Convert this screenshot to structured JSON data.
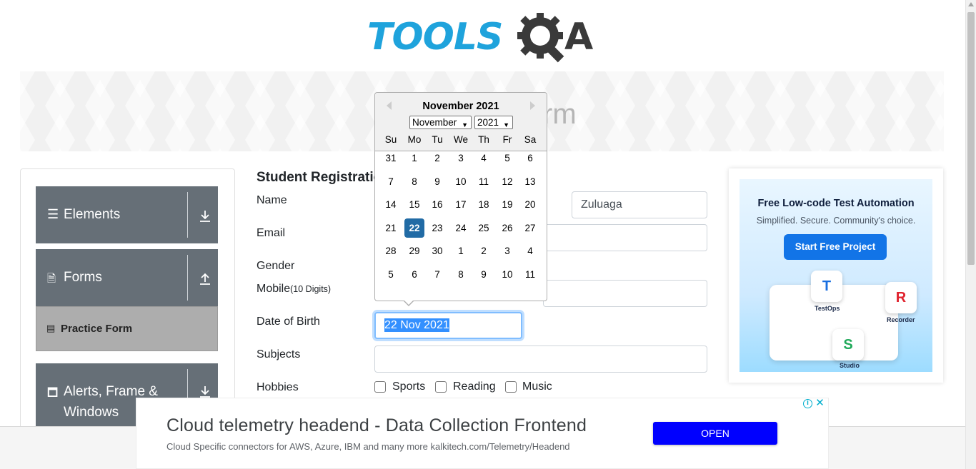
{
  "logo": {
    "text": "TOOLS",
    "suffix": "A"
  },
  "banner": {
    "title_fragment": "rm"
  },
  "sidebar": {
    "groups": [
      {
        "label": "Elements",
        "icon": "hamburger-icon",
        "arrow": "download-arrow-icon"
      },
      {
        "label": "Forms",
        "icon": "document-icon",
        "arrow": "upload-arrow-icon"
      },
      {
        "label_line1": "Alerts, Frame &",
        "label_line2": "Windows",
        "icon": "window-icon",
        "arrow": "download-arrow-icon"
      }
    ],
    "submenu": {
      "label": "Practice Form",
      "icon": "form-icon"
    }
  },
  "form": {
    "title": "Student Registratio",
    "labels": {
      "name": "Name",
      "email": "Email",
      "gender": "Gender",
      "mobile": "Mobile",
      "mobile_hint": "(10 Digits)",
      "dob": "Date of Birth",
      "subjects": "Subjects",
      "hobbies": "Hobbies"
    },
    "last_name": "Zuluaga",
    "dob_value": "22 Nov 2021",
    "hobbies": [
      "Sports",
      "Reading",
      "Music"
    ]
  },
  "datepicker": {
    "title": "November 2021",
    "month_select": "November",
    "year_select": "2021",
    "weekdays": [
      "Su",
      "Mo",
      "Tu",
      "We",
      "Th",
      "Fr",
      "Sa"
    ],
    "weeks": [
      [
        "31",
        "1",
        "2",
        "3",
        "4",
        "5",
        "6"
      ],
      [
        "7",
        "8",
        "9",
        "10",
        "11",
        "12",
        "13"
      ],
      [
        "14",
        "15",
        "16",
        "17",
        "18",
        "19",
        "20"
      ],
      [
        "21",
        "22",
        "23",
        "24",
        "25",
        "26",
        "27"
      ],
      [
        "28",
        "29",
        "30",
        "1",
        "2",
        "3",
        "4"
      ],
      [
        "5",
        "6",
        "7",
        "8",
        "9",
        "10",
        "11"
      ]
    ],
    "selected_day": "22"
  },
  "ad_right": {
    "headline": "Free Low-code Test Automation",
    "subline": "Simplified. Secure. Community's choice.",
    "button": "Start Free Project",
    "badges": {
      "testops": "TestOps",
      "recorder": "Recorder",
      "studio": "Studio"
    }
  },
  "ad_bottom": {
    "headline": "Cloud telemetry headend - Data Collection Frontend",
    "subline": "Cloud Specific connectors for AWS, Azure, IBM and many more kalkitech.com/Telemetry/Headend",
    "button": "OPEN"
  },
  "colors": {
    "sidebar_bg": "#666f77",
    "submenu_bg": "#adadad",
    "datepicker_selected": "#216ba5",
    "logo_blue": "#1fa3dc",
    "ad_button": "#0000ff"
  }
}
